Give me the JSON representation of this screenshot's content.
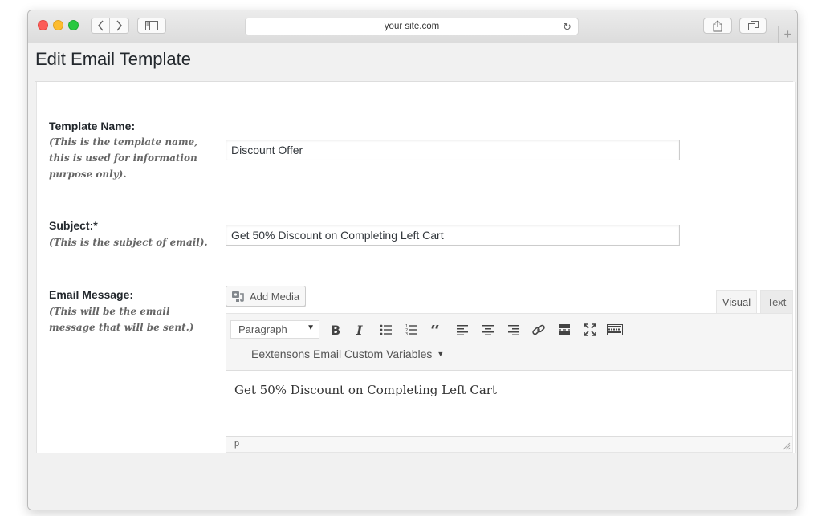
{
  "browser": {
    "url": "your site.com"
  },
  "page": {
    "title": "Edit Email Template"
  },
  "form": {
    "template_name": {
      "label": "Template Name:",
      "hint": "(This is the template name, this is used for information purpose only).",
      "value": "Discount Offer"
    },
    "subject": {
      "label": "Subject:*",
      "hint": "(This is the subject of email).",
      "value": "Get 50% Discount on Completing Left Cart"
    },
    "email_message": {
      "label": "Email Message:",
      "hint": "(This will be the email message that will be sent.)"
    }
  },
  "editor": {
    "add_media_label": "Add Media",
    "tabs": {
      "visual": "Visual",
      "text": "Text"
    },
    "format_select": "Paragraph",
    "custom_vars_label": "Eextensons Email Custom Variables",
    "body_text": "Get 50% Discount on Completing Left Cart",
    "path": "p",
    "toolbar_icons": [
      "bold-icon",
      "italic-icon",
      "bulleted-list-icon",
      "numbered-list-icon",
      "blockquote-icon",
      "align-left-icon",
      "align-center-icon",
      "align-right-icon",
      "link-icon",
      "read-more-icon",
      "fullscreen-icon",
      "toolbar-toggle-icon"
    ]
  }
}
